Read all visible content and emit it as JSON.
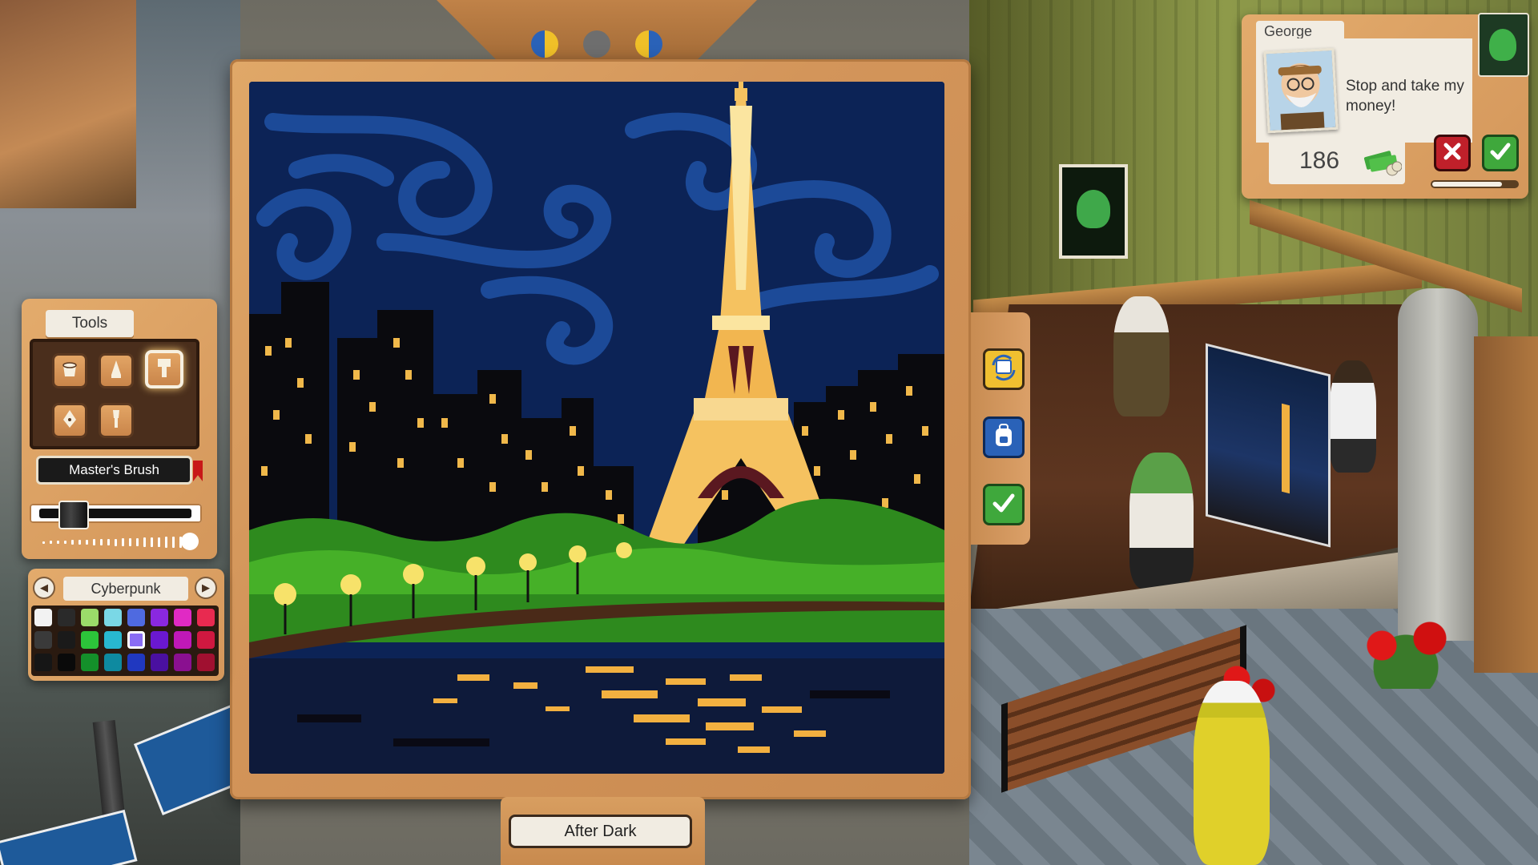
{
  "painting": {
    "title": "After Dark"
  },
  "tools": {
    "tab_label": "Tools",
    "items": [
      {
        "icon": "bucket-icon"
      },
      {
        "icon": "pencil-icon"
      },
      {
        "icon": "wide-brush-icon"
      },
      {
        "icon": "pen-nib-icon"
      },
      {
        "icon": "small-brush-icon"
      }
    ],
    "selected_index": 2,
    "selected_brush_name": "Master's Brush",
    "opacity_level": 0.15
  },
  "palette": {
    "name": "Cyberpunk",
    "prev_icon": "chevron-left-icon",
    "next_icon": "chevron-right-icon",
    "selected_swatch": "row2-col5",
    "rows": [
      [
        "#f2f2f2",
        "#2a2a2a",
        "#9bdc6a",
        "#7ad8e6",
        "#4f6ae0",
        "#8a28e0",
        "#e02ac4",
        "#e82a50"
      ],
      [
        "#3a3a3a",
        "#1a1a1a",
        "#2cc43a",
        "#28b8d0",
        "#8a6cf4",
        "#6a18d0",
        "#c018b8",
        "#d01840"
      ],
      [
        "#161616",
        "#0a0a0a",
        "#14902a",
        "#0e8aa0",
        "#2038c0",
        "#4a10a0",
        "#8a1090",
        "#a01030"
      ]
    ]
  },
  "side_actions": [
    {
      "icon": "swap-reference-icon"
    },
    {
      "icon": "backpack-icon"
    },
    {
      "icon": "checkmark-icon"
    }
  ],
  "order": {
    "customer_name": "George",
    "quote": "Stop and take my money!",
    "reward": "186",
    "reward_icon": "cash-stack-icon",
    "decline_icon": "x-icon",
    "accept_icon": "checkmark-icon",
    "patience": 0.82
  },
  "colors": {
    "frame_wood": "#d3955a",
    "accept_green": "#3fa83c",
    "decline_red": "#c0202a",
    "sky": "#0c2356"
  }
}
